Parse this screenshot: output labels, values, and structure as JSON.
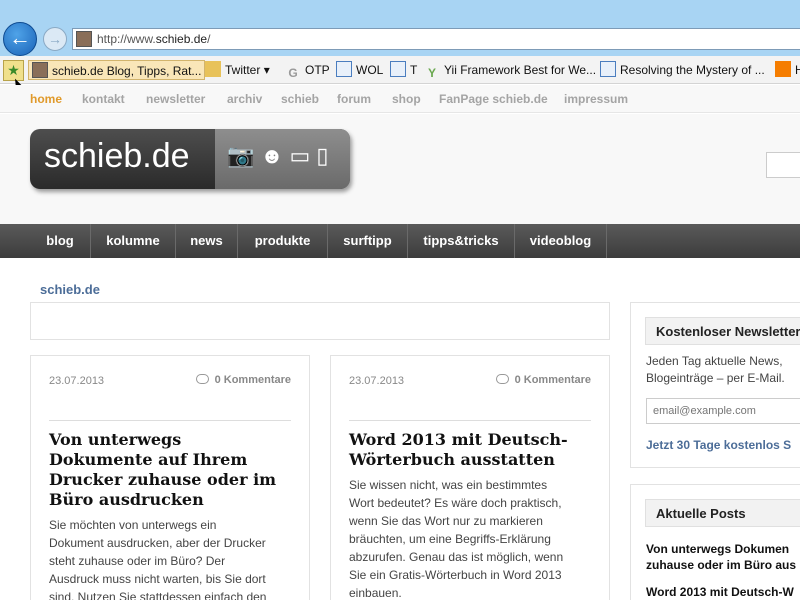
{
  "browser": {
    "url_prefix": "http://www.",
    "url_host": "schieb.de",
    "url_suffix": "/",
    "favorites": [
      {
        "label": "schieb.de  Blog, Tipps, Rat..."
      },
      {
        "label": "Twitter"
      },
      {
        "label": "OTP"
      },
      {
        "label": "WOL"
      },
      {
        "label": "T"
      },
      {
        "label": "Yii Framework Best for We..."
      },
      {
        "label": "Resolving the Mystery of ..."
      },
      {
        "label": "H"
      }
    ]
  },
  "topnav": [
    "home",
    "kontakt",
    "newsletter",
    "archiv",
    "schieb",
    "forum",
    "shop",
    "FanPage schieb.de",
    "impressum"
  ],
  "logo": {
    "text": "schieb.de"
  },
  "mainnav": [
    "blog",
    "kolumne",
    "news",
    "produkte",
    "surftipp",
    "tipps&tricks",
    "videoblog"
  ],
  "breadcrumb": "schieb.de",
  "posts": [
    {
      "date": "23.07.2013",
      "comments": "0 Kommentare",
      "title_lines": [
        "Von unterwegs",
        "Dokumente auf Ihrem",
        "Drucker zuhause oder im",
        "Büro ausdrucken"
      ],
      "excerpt_lines": [
        "Sie möchten von unterwegs ein",
        "Dokument ausdrucken, aber der Drucker",
        "steht zuhause oder im Büro? Der",
        "Ausdruck muss nicht warten, bis Sie dort",
        "sind. Nutzen Sie stattdessen einfach den"
      ]
    },
    {
      "date": "23.07.2013",
      "comments": "0 Kommentare",
      "title_lines": [
        "Word 2013 mit Deutsch-",
        "Wörterbuch ausstatten"
      ],
      "excerpt_lines": [
        "Sie wissen nicht, was ein bestimmtes",
        "Wort bedeutet? Es wäre doch praktisch,",
        "wenn Sie das Wort nur zu markieren",
        "bräuchten, um eine Begriffs-Erklärung",
        "abzurufen. Genau das ist möglich, wenn",
        "Sie ein Gratis-Wörterbuch in Word 2013",
        "einbauen."
      ]
    }
  ],
  "newsletter": {
    "heading": "Kostenloser Newsletter",
    "text_lines": [
      "Jeden Tag aktuelle News,",
      "Blogeinträge – per E-Mail."
    ],
    "email_placeholder": "email@example.com",
    "cta": "Jetzt 30 Tage kostenlos S"
  },
  "recent": {
    "heading": "Aktuelle Posts",
    "items": [
      {
        "lines": [
          "Von unterwegs Dokumen",
          "zuhause oder im Büro aus"
        ]
      },
      {
        "lines": [
          "Word 2013 mit Deutsch-W"
        ]
      }
    ]
  }
}
